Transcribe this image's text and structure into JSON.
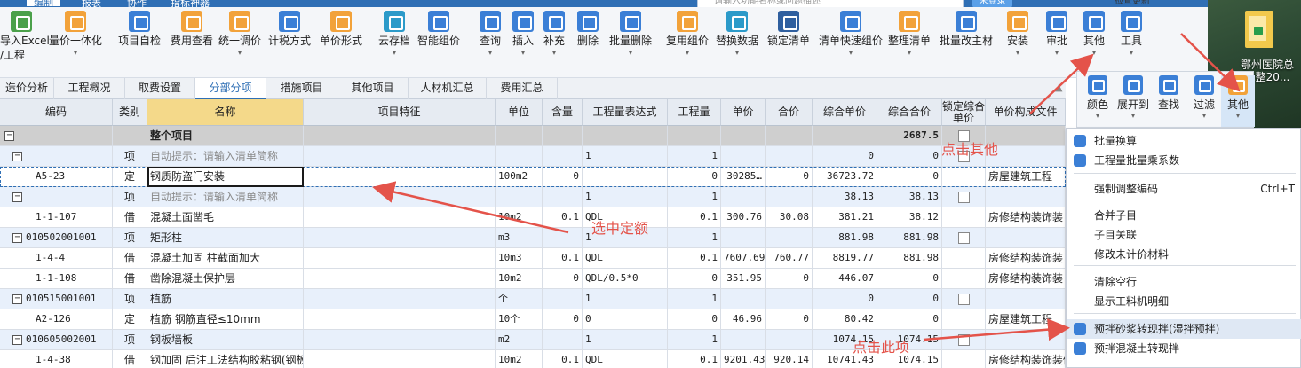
{
  "top_menu": [
    "编制",
    "报表",
    "协作",
    "指标神器"
  ],
  "top_menu_active": 0,
  "search_placeholder": "请输入功能名称或问题描述",
  "login_label": "未登录",
  "check_update_label": "检查更新",
  "ribbon": {
    "import_label_1": "导入Excel",
    "import_label_2": "/工程",
    "buttons": [
      {
        "label": "量价一体化",
        "icon": "price-integration-icon",
        "caret": true
      },
      {
        "label": "项目自检",
        "icon": "self-check-icon",
        "caret": false
      },
      {
        "label": "费用查看",
        "icon": "fee-view-icon",
        "caret": false
      },
      {
        "label": "统一调价",
        "icon": "unified-price-icon",
        "caret": true
      },
      {
        "label": "计税方式",
        "icon": "tax-method-icon",
        "caret": false
      },
      {
        "label": "单价形式",
        "icon": "unit-price-form-icon",
        "caret": false
      },
      {
        "label": "云存档",
        "icon": "cloud-archive-icon",
        "caret": true
      },
      {
        "label": "智能组价",
        "icon": "smart-pricing-icon",
        "caret": false
      },
      {
        "label": "查询",
        "icon": "query-icon",
        "caret": true
      },
      {
        "label": "插入",
        "icon": "insert-icon",
        "caret": true
      },
      {
        "label": "补充",
        "icon": "supplement-icon",
        "caret": true
      },
      {
        "label": "删除",
        "icon": "delete-icon",
        "caret": false
      },
      {
        "label": "批量删除",
        "icon": "batch-delete-icon",
        "caret": true
      },
      {
        "label": "复用组价",
        "icon": "reuse-pricing-icon",
        "caret": true
      },
      {
        "label": "替换数据",
        "icon": "replace-data-icon",
        "caret": true
      },
      {
        "label": "锁定清单",
        "icon": "lock-list-icon",
        "caret": false
      },
      {
        "label": "清单快速组价",
        "icon": "quick-pricing-icon",
        "caret": true
      },
      {
        "label": "整理清单",
        "icon": "organize-list-icon",
        "caret": true
      },
      {
        "label": "批量改主材",
        "icon": "batch-material-icon",
        "caret": false
      },
      {
        "label": "安装",
        "icon": "install-icon",
        "caret": true
      },
      {
        "label": "审批",
        "icon": "approve-icon",
        "caret": true
      },
      {
        "label": "其他",
        "icon": "other-icon",
        "caret": true
      },
      {
        "label": "工具",
        "icon": "tool-icon",
        "caret": true
      }
    ]
  },
  "tabs": [
    "造价分析",
    "工程概况",
    "取费设置",
    "分部分项",
    "措施项目",
    "其他项目",
    "人材机汇总",
    "费用汇总"
  ],
  "active_tab": 3,
  "columns": [
    "编码",
    "类别",
    "名称",
    "项目特征",
    "单位",
    "含量",
    "工程量表达式",
    "工程量",
    "单价",
    "合价",
    "综合单价",
    "综合合价",
    "锁定综合单价",
    "单价构成文件"
  ],
  "rows": [
    {
      "type": "total",
      "code": "",
      "cat": "",
      "name": "整个项目",
      "feature": "",
      "unit": "",
      "content": "",
      "expr": "",
      "qty": "",
      "price": "",
      "amount": "",
      "comp_price": "",
      "comp_amount": "2687.5",
      "lock": false,
      "file": "",
      "toggle": "−"
    },
    {
      "type": "item",
      "code": "",
      "cat": "项",
      "name": "自动提示：请输入清单简称",
      "feature": "",
      "unit": "",
      "content": "",
      "expr": "1",
      "qty": "1",
      "price": "",
      "amount": "",
      "comp_price": "0",
      "comp_amount": "0",
      "lock": false,
      "file": "",
      "toggle": "−"
    },
    {
      "type": "selected",
      "code": "A5-23",
      "cat": "定",
      "name": "钢质防盗门安装",
      "feature": "",
      "unit": "100m2",
      "content": "0",
      "expr": "",
      "qty": "0",
      "price": "30285…",
      "amount": "0",
      "comp_price": "36723.72",
      "comp_amount": "0",
      "lock": null,
      "file": "房屋建筑工程",
      "toggle": ""
    },
    {
      "type": "item",
      "code": "",
      "cat": "项",
      "name": "自动提示：请输入清单简称",
      "feature": "",
      "unit": "",
      "content": "",
      "expr": "1",
      "qty": "1",
      "price": "",
      "amount": "",
      "comp_price": "38.13",
      "comp_amount": "38.13",
      "lock": false,
      "file": "",
      "toggle": "−"
    },
    {
      "type": "quota",
      "code": "1-1-107",
      "cat": "借",
      "name": "混凝土面凿毛",
      "feature": "",
      "unit": "10m2",
      "content": "0.1",
      "expr": "QDL",
      "qty": "0.1",
      "price": "300.76",
      "amount": "30.08",
      "comp_price": "381.21",
      "comp_amount": "38.12",
      "lock": null,
      "file": "房修结构装饰装",
      "toggle": ""
    },
    {
      "type": "item",
      "code": "010502001001",
      "cat": "项",
      "name": "矩形柱",
      "feature": "",
      "unit": "m3",
      "content": "",
      "expr": "1",
      "qty": "1",
      "price": "",
      "amount": "",
      "comp_price": "881.98",
      "comp_amount": "881.98",
      "lock": false,
      "file": "",
      "toggle": "−"
    },
    {
      "type": "quota",
      "code": "1-4-4",
      "cat": "借",
      "name": "混凝土加固 柱截面加大",
      "feature": "",
      "unit": "10m3",
      "content": "0.1",
      "expr": "QDL",
      "qty": "0.1",
      "price": "7607.69",
      "amount": "760.77",
      "comp_price": "8819.77",
      "comp_amount": "881.98",
      "lock": null,
      "file": "房修结构装饰装",
      "toggle": ""
    },
    {
      "type": "quota",
      "code": "1-1-108",
      "cat": "借",
      "name": "凿除混凝土保护层",
      "feature": "",
      "unit": "10m2",
      "content": "0",
      "expr": "QDL/0.5*0",
      "qty": "0",
      "price": "351.95",
      "amount": "0",
      "comp_price": "446.07",
      "comp_amount": "0",
      "lock": null,
      "file": "房修结构装饰装",
      "toggle": ""
    },
    {
      "type": "item",
      "code": "010515001001",
      "cat": "项",
      "name": "植筋",
      "feature": "",
      "unit": "个",
      "content": "",
      "expr": "1",
      "qty": "1",
      "price": "",
      "amount": "",
      "comp_price": "0",
      "comp_amount": "0",
      "lock": false,
      "file": "",
      "toggle": "−"
    },
    {
      "type": "quota",
      "code": "A2-126",
      "cat": "定",
      "name": "植筋 钢筋直径≤10mm",
      "feature": "",
      "unit": "10个",
      "content": "0",
      "expr": "0",
      "qty": "0",
      "price": "46.96",
      "amount": "0",
      "comp_price": "80.42",
      "comp_amount": "0",
      "lock": null,
      "file": "房屋建筑工程",
      "toggle": ""
    },
    {
      "type": "item",
      "code": "010605002001",
      "cat": "项",
      "name": "钢板墙板",
      "feature": "",
      "unit": "m2",
      "content": "",
      "expr": "1",
      "qty": "1",
      "price": "",
      "amount": "",
      "comp_price": "1074.15",
      "comp_amount": "1074.15",
      "lock": false,
      "file": "",
      "toggle": "−"
    },
    {
      "type": "quota",
      "code": "1-4-38",
      "cat": "借",
      "name": "钢加固 后注工法结构胶粘钢(钢板厚度...",
      "feature": "",
      "unit": "10m2",
      "content": "0.1",
      "expr": "QDL",
      "qty": "0.1",
      "price": "9201.43",
      "amount": "920.14",
      "comp_price": "10741.43",
      "comp_amount": "1074.15",
      "lock": null,
      "file": "房修结构装饰装修工程",
      "toggle": ""
    }
  ],
  "float_toolbar": [
    {
      "label": "颜色",
      "icon": "color-icon",
      "caret": true
    },
    {
      "label": "展开到",
      "icon": "expand-to-icon",
      "caret": true
    },
    {
      "label": "查找",
      "icon": "find-icon",
      "caret": false
    },
    {
      "label": "过滤",
      "icon": "filter-icon",
      "caret": true
    },
    {
      "label": "其他",
      "icon": "other-icon",
      "caret": true
    }
  ],
  "menu_items": [
    {
      "label": "批量换算",
      "icon": true,
      "shortcut": "",
      "sep_after": false
    },
    {
      "label": "工程量批量乘系数",
      "icon": true,
      "shortcut": "",
      "sep_after": true
    },
    {
      "label": "强制调整编码",
      "icon": false,
      "shortcut": "Ctrl+T",
      "sep_after": true
    },
    {
      "label": "合并子目",
      "icon": false,
      "shortcut": "",
      "sep_after": false
    },
    {
      "label": "子目关联",
      "icon": false,
      "shortcut": "",
      "sep_after": false
    },
    {
      "label": "修改未计价材料",
      "icon": false,
      "shortcut": "",
      "sep_after": true
    },
    {
      "label": "清除空行",
      "icon": false,
      "shortcut": "",
      "sep_after": false
    },
    {
      "label": "显示工料机明细",
      "icon": false,
      "shortcut": "",
      "sep_after": true
    },
    {
      "label": "预拌砂浆转现拌(湿拌预拌)",
      "icon": true,
      "shortcut": "",
      "sep_after": false,
      "hover": true
    },
    {
      "label": "预拌混凝土转现拌",
      "icon": true,
      "shortcut": "",
      "sep_after": false
    }
  ],
  "desktop_folder_label": "鄂州医院总包整20...",
  "annotations": {
    "click_other": "点击其他",
    "select_quota": "选中定额",
    "click_this": "点击此项"
  },
  "colors": {
    "accent": "#2f6fb5",
    "annotation": "#e4534a"
  }
}
